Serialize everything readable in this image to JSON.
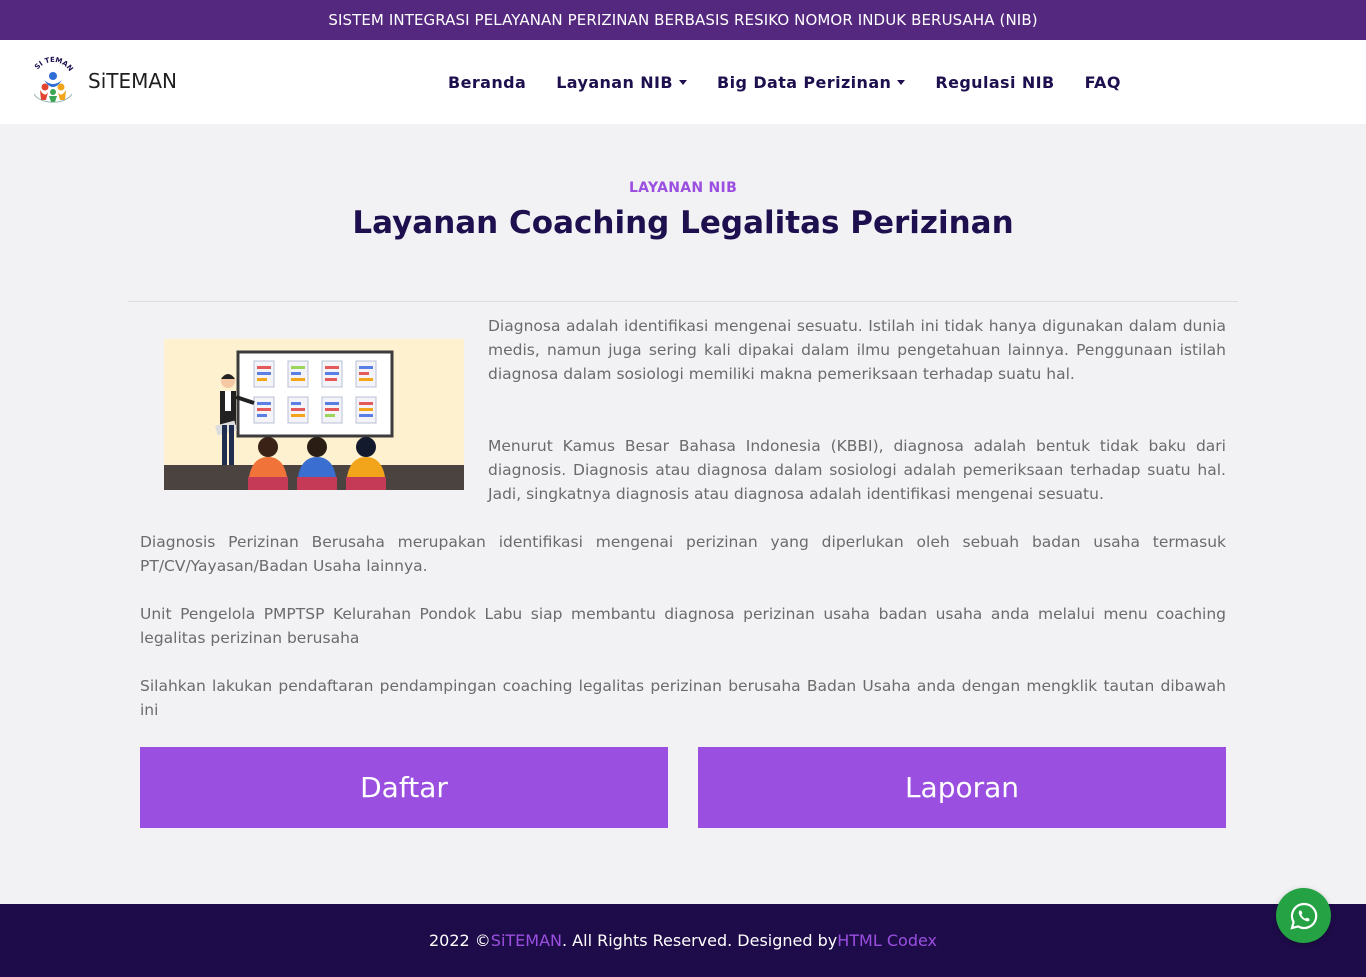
{
  "topbar": {
    "text": "SISTEM INTEGRASI PELAYANAN PERIZINAN BERBASIS RESIKO NOMOR INDUK BERUSAHA (NIB)"
  },
  "brand": {
    "name": "SiTEMAN",
    "logo_text": "SI TEMAN"
  },
  "nav": {
    "items": [
      {
        "label": "Beranda",
        "dropdown": false
      },
      {
        "label": "Layanan NIB",
        "dropdown": true
      },
      {
        "label": "Big Data Perizinan",
        "dropdown": true
      },
      {
        "label": "Regulasi NIB",
        "dropdown": false
      },
      {
        "label": "FAQ",
        "dropdown": false
      }
    ]
  },
  "main": {
    "section_label": "LAYANAN NIB",
    "title": "Layanan Coaching Legalitas Perizinan",
    "paragraphs": [
      "Diagnosa adalah identifikasi mengenai sesuatu. Istilah ini tidak hanya digunakan dalam dunia medis, namun juga sering kali dipakai dalam ilmu pengetahuan lainnya. Penggunaan istilah diagnosa dalam sosiologi memiliki makna pemeriksaan terhadap suatu hal.",
      "Menurut Kamus Besar Bahasa Indonesia (KBBI), diagnosa adalah bentuk tidak baku dari diagnosis. Diagnosis atau diagnosa dalam sosiologi adalah pemeriksaan terhadap suatu hal. Jadi, singkatnya diagnosis atau diagnosa adalah identifikasi mengenai sesuatu.",
      "Diagnosis Perizinan Berusaha merupakan identifikasi mengenai perizinan yang diperlukan oleh sebuah badan usaha termasuk PT/CV/Yayasan/Badan Usaha lainnya.",
      "Unit Pengelola PMPTSP Kelurahan Pondok Labu siap membantu diagnosa perizinan usaha badan usaha anda melalui menu coaching legalitas perizinan berusaha",
      "Silahkan lakukan pendaftaran pendampingan coaching legalitas perizinan berusaha Badan Usaha anda dengan mengklik tautan dibawah ini"
    ],
    "buttons": {
      "daftar": "Daftar",
      "laporan": "Laporan"
    }
  },
  "footer": {
    "prefix": "2022 © ",
    "brand_link": "SiTEMAN",
    "middle": ". All Rights Reserved. Designed by ",
    "designer_link": "HTML Codex"
  },
  "icons": {
    "whatsapp": "whatsapp-icon"
  },
  "colors": {
    "topbar": "#55287f",
    "accent": "#9b4fe0",
    "navy": "#1e0f4e",
    "footer": "#1e0c4a",
    "whatsapp": "#25a244"
  }
}
